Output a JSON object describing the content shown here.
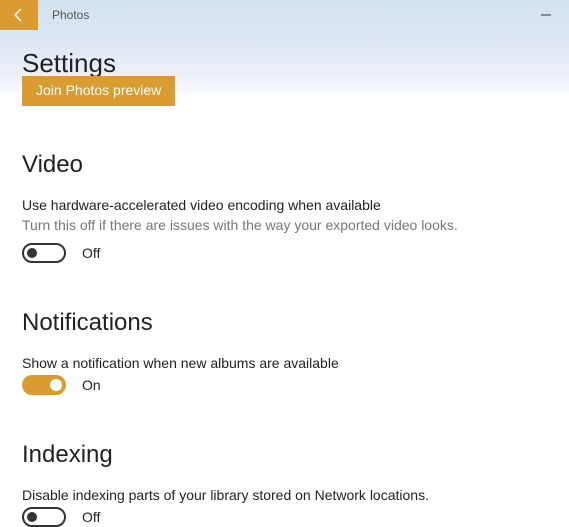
{
  "titlebar": {
    "app_name": "Photos"
  },
  "header": {
    "page_title": "Settings",
    "preview_button": "Join Photos preview"
  },
  "sections": {
    "video": {
      "heading": "Video",
      "label": "Use hardware-accelerated video encoding when available",
      "description": "Turn this off if there are issues with the way your exported video looks.",
      "state_text": "Off",
      "state": false
    },
    "notifications": {
      "heading": "Notifications",
      "label": "Show a notification when new albums are available",
      "state_text": "On",
      "state": true
    },
    "indexing": {
      "heading": "Indexing",
      "label": "Disable indexing parts of your library stored on Network locations.",
      "state_text": "Off",
      "state": false
    }
  }
}
